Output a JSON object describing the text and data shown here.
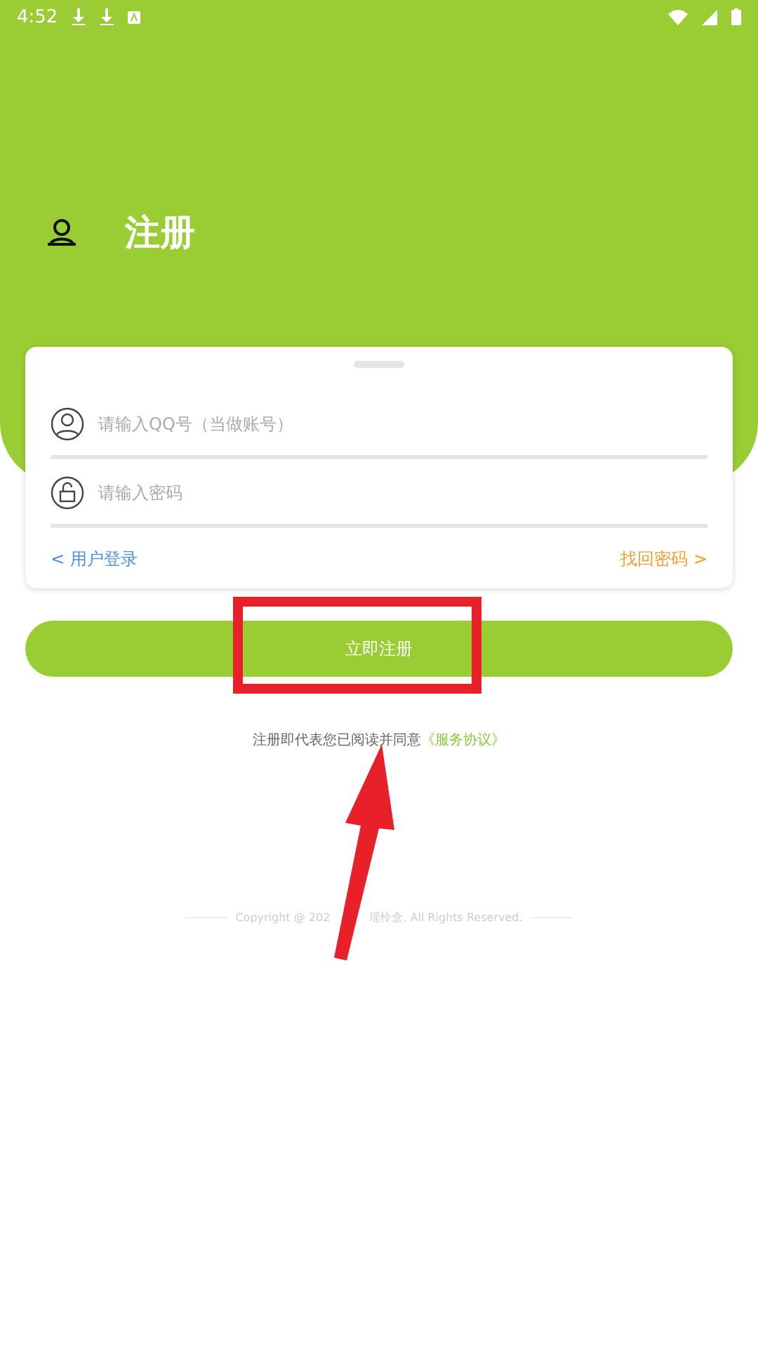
{
  "status_bar": {
    "time": "4:52"
  },
  "header": {
    "title": "注册"
  },
  "form": {
    "fields": [
      {
        "kind": "user",
        "placeholder": "请输入QQ号（当做账号）"
      },
      {
        "kind": "password",
        "placeholder": "请输入密码"
      }
    ],
    "login_link": "< 用户登录",
    "recover_link": "找回密码 >"
  },
  "submit_button": "立即注册",
  "agreement": {
    "text": "注册即代表您已阅读并同意",
    "link": "《服务协议》"
  },
  "copyright": [
    "Copyright @ 202",
    "瑶怜盒. All Rights Reserved."
  ]
}
